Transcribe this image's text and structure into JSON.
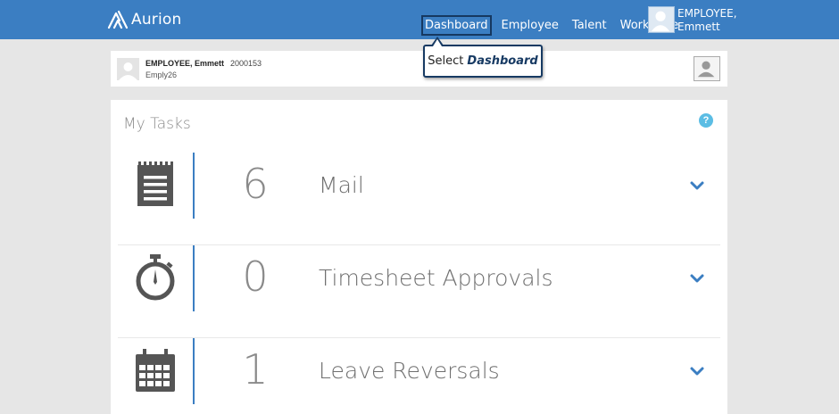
{
  "header": {
    "brand": "Aurion",
    "nav": [
      "Dashboard",
      "Employee",
      "Talent",
      "Workforce"
    ],
    "user_line1": "EMPLOYEE,",
    "user_line2": "Emmett"
  },
  "tooltip": {
    "prefix": "Select",
    "target": "Dashboard"
  },
  "employee": {
    "name": "EMPLOYEE, Emmett",
    "id": "2000153",
    "code": "Emply26"
  },
  "tasks": {
    "title": "My Tasks",
    "help": "?",
    "items": [
      {
        "count": "6",
        "label": "Mail",
        "icon": "notepad-icon"
      },
      {
        "count": "0",
        "label": "Timesheet Approvals",
        "icon": "stopwatch-icon"
      },
      {
        "count": "1",
        "label": "Leave Reversals",
        "icon": "calendar-icon"
      }
    ]
  },
  "colors": {
    "header_bg": "#3b7ec2",
    "accent": "#3b7ec2",
    "tooltip_border": "#173a63",
    "help_icon": "#5bbde4"
  }
}
